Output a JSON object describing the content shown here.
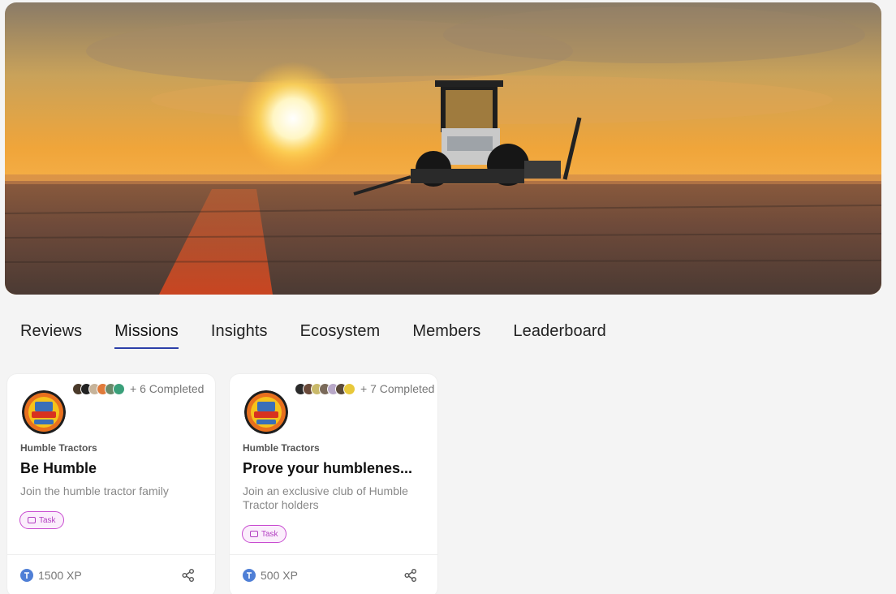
{
  "tabs": [
    {
      "label": "Reviews",
      "active": false
    },
    {
      "label": "Missions",
      "active": true
    },
    {
      "label": "Insights",
      "active": false
    },
    {
      "label": "Ecosystem",
      "active": false
    },
    {
      "label": "Members",
      "active": false
    },
    {
      "label": "Leaderboard",
      "active": false
    }
  ],
  "missions": [
    {
      "completed": "+ 6 Completed",
      "brand": "Humble Tractors",
      "title": "Be Humble",
      "description": "Join the humble tractor family",
      "chip": "Task",
      "xp": "1500 XP"
    },
    {
      "completed": "+ 7 Completed",
      "brand": "Humble Tractors",
      "title": "Prove your humblenes...",
      "description": "Join an exclusive club of Humble Tractor holders",
      "chip": "Task",
      "xp": "500 XP"
    }
  ],
  "colors": {
    "accent": "#2b3fa8",
    "chip_border": "#c84bd0",
    "xp_icon": "#4f7fd6"
  },
  "icons": {
    "xp": "token-icon",
    "share": "share-icon",
    "chip": "ticket-icon"
  }
}
